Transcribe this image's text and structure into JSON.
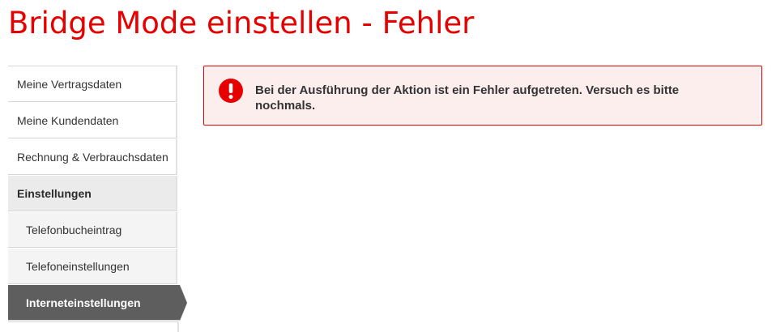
{
  "page": {
    "title": "Bridge Mode einstellen - Fehler"
  },
  "sidebar": {
    "items": [
      {
        "label": "Meine Vertragsdaten",
        "kind": "item"
      },
      {
        "label": "Meine Kundendaten",
        "kind": "item"
      },
      {
        "label": "Rechnung & Verbrauchsdaten",
        "kind": "item"
      },
      {
        "label": "Einstellungen",
        "kind": "section"
      },
      {
        "label": "Telefonbucheintrag",
        "kind": "sub"
      },
      {
        "label": "Telefoneinstellungen",
        "kind": "sub"
      },
      {
        "label": "Interneteinstellungen",
        "kind": "active"
      }
    ]
  },
  "alert": {
    "type": "error",
    "icon": "exclamation-circle-icon",
    "message": "Bei der Ausführung der Aktion ist ein Fehler aufgetreten. Versuch es bitte nochmals."
  },
  "colors": {
    "brand": "#e60000",
    "alert_background": "#fdeeee",
    "active_item_background": "#5e5e5e"
  }
}
